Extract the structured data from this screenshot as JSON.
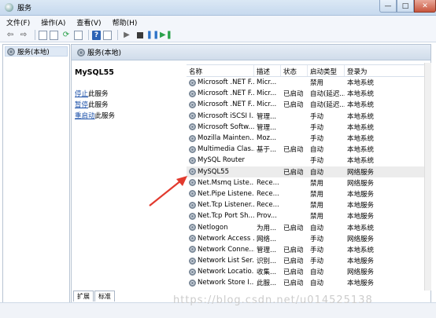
{
  "window": {
    "title": "服务"
  },
  "window_controls": {
    "minimize": "—",
    "maximize": "□",
    "close": "✕"
  },
  "menu": [
    "文件(F)",
    "操作(A)",
    "查看(V)",
    "帮助(H)"
  ],
  "tree": {
    "root_label": "服务(本地)"
  },
  "panel": {
    "header": "服务(本地)"
  },
  "details": {
    "service_name": "MySQL55",
    "actions": [
      {
        "link": "停止",
        "suffix": "此服务"
      },
      {
        "link": "暂停",
        "suffix": "此服务"
      },
      {
        "link": "重启动",
        "suffix": "此服务"
      }
    ]
  },
  "list": {
    "columns": [
      "名称",
      "描述",
      "状态",
      "启动类型",
      "登录为"
    ],
    "rows": [
      [
        "Microsoft .NET F...",
        "Micr...",
        "",
        "禁用",
        "本地系统"
      ],
      [
        "Microsoft .NET F...",
        "Micr...",
        "已启动",
        "自动(延迟...",
        "本地系统"
      ],
      [
        "Microsoft .NET F...",
        "Micr...",
        "已启动",
        "自动(延迟...",
        "本地系统"
      ],
      [
        "Microsoft iSCSI I...",
        "管理...",
        "",
        "手动",
        "本地系统"
      ],
      [
        "Microsoft Softw...",
        "管理...",
        "",
        "手动",
        "本地系统"
      ],
      [
        "Mozilla Mainten...",
        "Moz...",
        "",
        "手动",
        "本地系统"
      ],
      [
        "Multimedia Clas...",
        "基于...",
        "已启动",
        "自动",
        "本地系统"
      ],
      [
        "MySQL Router",
        "",
        "",
        "手动",
        "本地系统"
      ],
      [
        "MySQL55",
        "",
        "已启动",
        "自动",
        "网络服务"
      ],
      [
        "Net.Msmq Liste...",
        "Rece...",
        "",
        "禁用",
        "网络服务"
      ],
      [
        "Net.Pipe Listene...",
        "Rece...",
        "",
        "禁用",
        "本地服务"
      ],
      [
        "Net.Tcp Listener...",
        "Rece...",
        "",
        "禁用",
        "本地服务"
      ],
      [
        "Net.Tcp Port Sh...",
        "Prov...",
        "",
        "禁用",
        "本地服务"
      ],
      [
        "Netlogon",
        "为用...",
        "已启动",
        "自动",
        "本地系统"
      ],
      [
        "Network Access ...",
        "网络...",
        "",
        "手动",
        "网络服务"
      ],
      [
        "Network Conne...",
        "管理...",
        "已启动",
        "手动",
        "本地系统"
      ],
      [
        "Network List Ser...",
        "识别...",
        "已启动",
        "手动",
        "本地服务"
      ],
      [
        "Network Locatio...",
        "收集...",
        "已启动",
        "自动",
        "网络服务"
      ],
      [
        "Network Store I...",
        "此服...",
        "已启动",
        "自动",
        "本地服务"
      ]
    ],
    "selected_row": 8
  },
  "tabs": [
    "扩展",
    "标准"
  ],
  "watermark": "https://blog.csdn.net/u014525138",
  "colors": {
    "link": "#1a4fa8",
    "arrow": "#e23a2e",
    "header_bg": "#d0dcea"
  }
}
